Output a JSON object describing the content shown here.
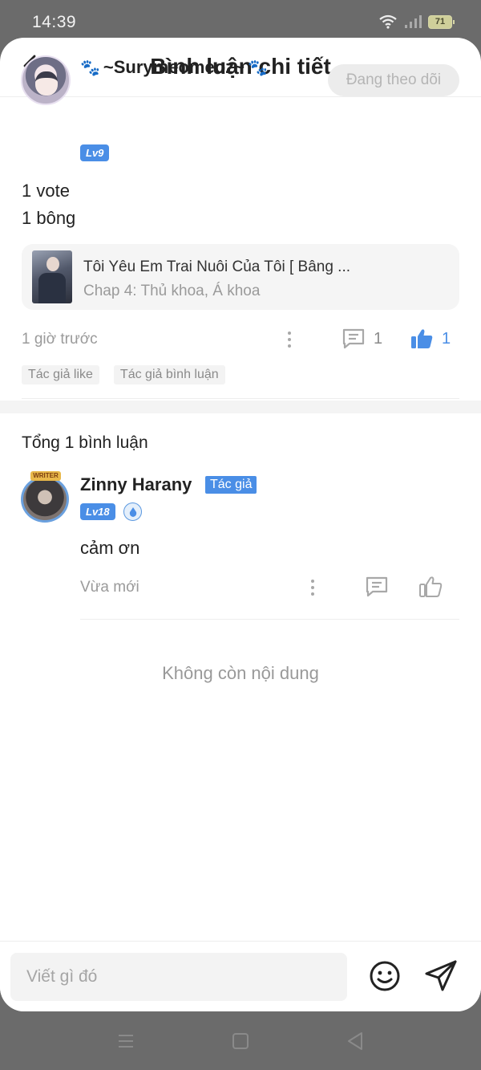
{
  "status_bar": {
    "time": "14:39",
    "battery": "71"
  },
  "header": {
    "title": "Bình luận chi tiết"
  },
  "post": {
    "username": "~Surymeomeoz~",
    "level": "Lv9",
    "follow_label": "Đang theo dõi",
    "text_lines": [
      "1 vote",
      "1 bông"
    ],
    "story": {
      "title": "Tôi Yêu Em Trai Nuôi Của Tôi [ Bâng ...",
      "chapter": "Chap 4: Thủ khoa, Á khoa"
    },
    "time": "1 giờ trước",
    "comment_count": "1",
    "like_count": "1",
    "tags": [
      "Tác giả like",
      "Tác giả bình luận"
    ]
  },
  "replies": {
    "total_label": "Tổng 1 bình luận",
    "items": [
      {
        "name": "Zinny Harany",
        "badge": "Tác giả",
        "level": "Lv18",
        "avatar_frame_label": "WRITER",
        "text": "cảm ơn",
        "time": "Vừa mới"
      }
    ]
  },
  "end_label": "Không còn nội dung",
  "input": {
    "placeholder": "Viết gì đó"
  },
  "colors": {
    "accent": "#4a8ee6",
    "muted": "#9a9a9a",
    "paw": "#d63845"
  }
}
